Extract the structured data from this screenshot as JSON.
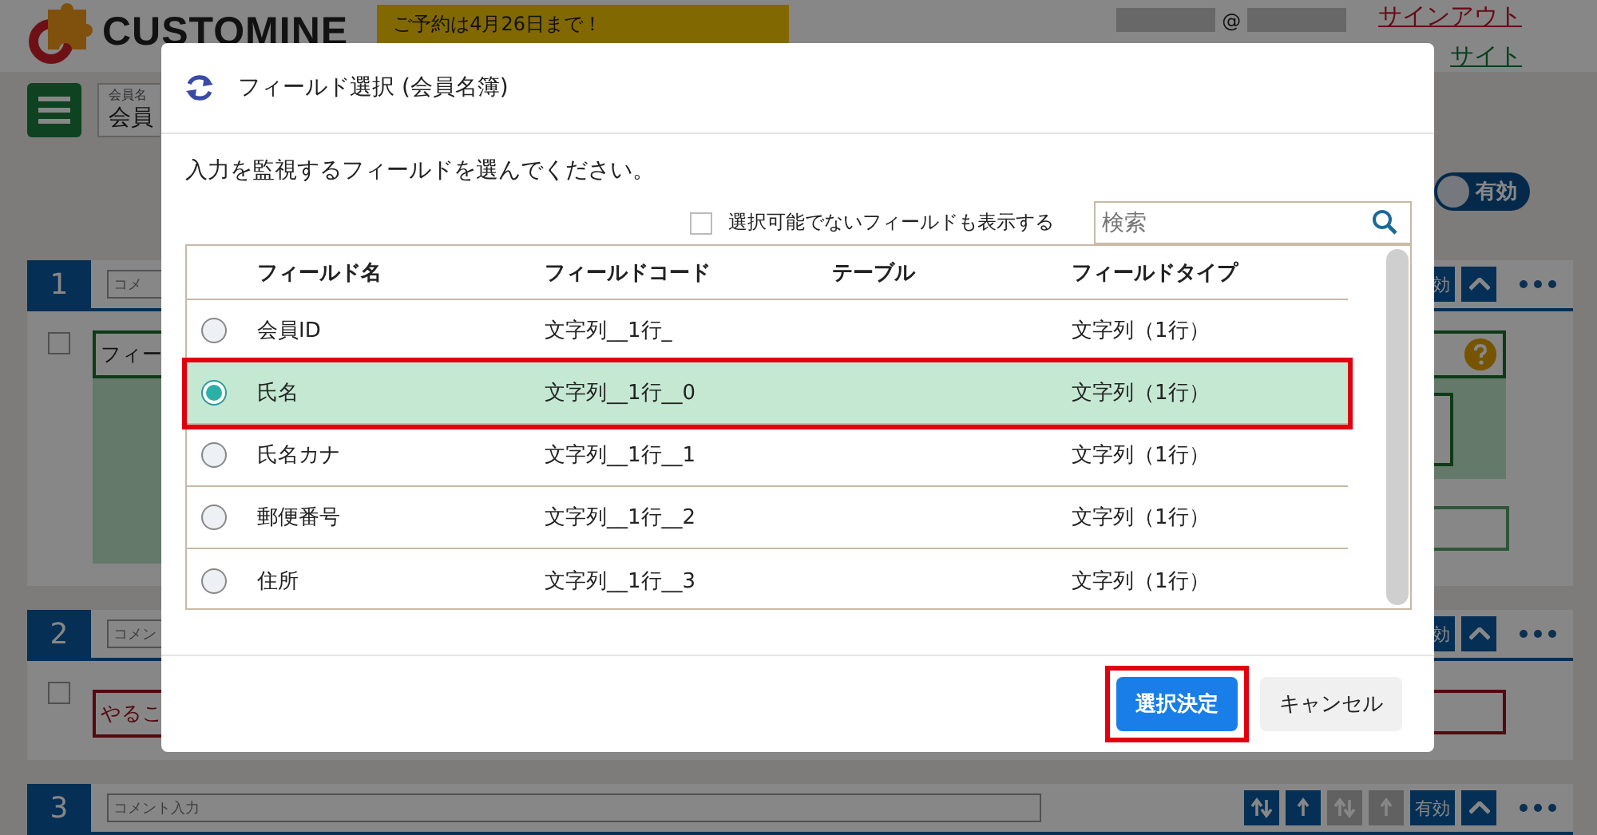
{
  "header": {
    "logo_text": "CUSTOMINE",
    "banner": "ご予約は4月26日まで！",
    "account": "@",
    "sign_out": "サインアウト",
    "site_link": "サイト"
  },
  "app_selector": {
    "label": "会員名",
    "value": "会員"
  },
  "status_toggle": {
    "label": "有効"
  },
  "blocks": [
    {
      "number": "1",
      "placeholder": "コメ",
      "enabled_label": "効",
      "body": {
        "kind": "condition",
        "text": "フィー",
        "checked": false
      }
    },
    {
      "number": "2",
      "placeholder": "コメン",
      "enabled_label": "効",
      "body": {
        "kind": "action",
        "text": "やるこ",
        "checked": false
      }
    },
    {
      "number": "3",
      "placeholder": "コメント入力",
      "enabled_label": "有効",
      "move_buttons": [
        {
          "disabled": false
        },
        {
          "disabled": false
        },
        {
          "disabled": true
        },
        {
          "disabled": true
        }
      ]
    }
  ],
  "dialog": {
    "title": "フィールド選択 (会員名簿)",
    "instruction": "入力を監視するフィールドを選んでください。",
    "show_unselectable": {
      "label": "選択可能でないフィールドも表示する",
      "checked": false
    },
    "search": {
      "placeholder": "検索"
    },
    "columns": [
      "フィールド名",
      "フィールドコード",
      "テーブル",
      "フィールドタイプ"
    ],
    "rows": [
      {
        "name": "会員ID",
        "code": "文字列__1行_",
        "type": "文字列（1行）",
        "selected": false,
        "highlighted": false
      },
      {
        "name": "氏名",
        "code": "文字列__1行__0",
        "type": "文字列（1行）",
        "selected": true,
        "highlighted": true
      },
      {
        "name": "氏名カナ",
        "code": "文字列__1行__1",
        "type": "文字列（1行）",
        "selected": false,
        "highlighted": false
      },
      {
        "name": "郵便番号",
        "code": "文字列__1行__2",
        "type": "文字列（1行）",
        "selected": false,
        "highlighted": false
      },
      {
        "name": "住所",
        "code": "文字列__1行__3",
        "type": "文字列（1行）",
        "selected": false,
        "highlighted": false
      }
    ],
    "buttons": [
      {
        "label": "選択決定",
        "kind": "primary",
        "highlighted": true
      },
      {
        "label": "キャンセル",
        "kind": "secondary",
        "highlighted": false
      }
    ]
  }
}
